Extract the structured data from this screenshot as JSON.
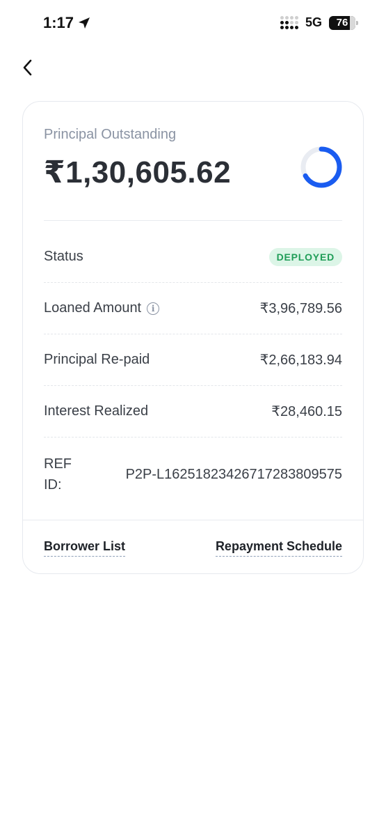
{
  "status_bar": {
    "time": "1:17",
    "network": "5G",
    "battery": "76"
  },
  "card": {
    "principal_outstanding_label": "Principal Outstanding",
    "principal_outstanding_value": "₹1,30,605.62",
    "progress_fraction_repaid": 0.67,
    "rows": {
      "status": {
        "label": "Status",
        "badge": "DEPLOYED"
      },
      "loaned": {
        "label": "Loaned Amount",
        "value": "₹3,96,789.56"
      },
      "repaid": {
        "label": "Principal Re-paid",
        "value": "₹2,66,183.94"
      },
      "interest": {
        "label": "Interest Realized",
        "value": "₹28,460.15"
      },
      "ref": {
        "label": "REF ID:",
        "value": "P2P-L16251823426717283809575"
      }
    },
    "links": {
      "borrower_list": "Borrower List",
      "repayment_schedule": "Repayment Schedule"
    }
  },
  "colors": {
    "accent_blue": "#1a5cf0",
    "ring_track": "#e9ecf2",
    "badge_bg": "#dcf5e7",
    "badge_text": "#1f9d57"
  },
  "icons": [
    "location-arrow-icon",
    "signal-icon",
    "battery-icon",
    "back-chevron-icon",
    "info-icon"
  ]
}
